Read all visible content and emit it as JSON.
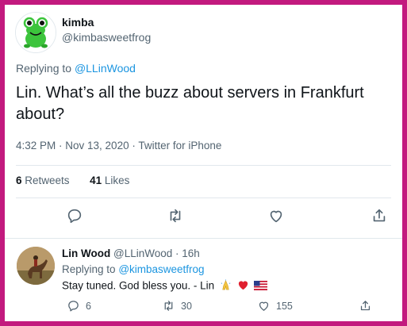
{
  "tweet": {
    "display_name": "kimba",
    "handle": "@kimbasweetfrog",
    "replying_label": "Replying to",
    "replying_to": "@LLinWood",
    "text": "Lin. What’s all the buzz about servers in Frankfurt about?",
    "meta": "4:32 PM · Nov 13, 2020 · Twitter for iPhone",
    "retweets_count": "6",
    "retweets_label": "Retweets",
    "likes_count": "41",
    "likes_label": "Likes"
  },
  "reply": {
    "display_name": "Lin Wood",
    "handle_time": "@LLinWood · 16h",
    "replying_label": "Replying to",
    "replying_to": "@kimbasweetfrog",
    "text": "Stay tuned. God bless you. - Lin",
    "emojis": [
      "folded-hands",
      "red-heart",
      "us-flag"
    ],
    "reply_count": "6",
    "retweet_count": "30",
    "like_count": "155"
  },
  "colors": {
    "border": "#c21a7e",
    "link": "#1b95e0",
    "secondary_text": "#536471",
    "frog_green": "#3cc43c"
  }
}
